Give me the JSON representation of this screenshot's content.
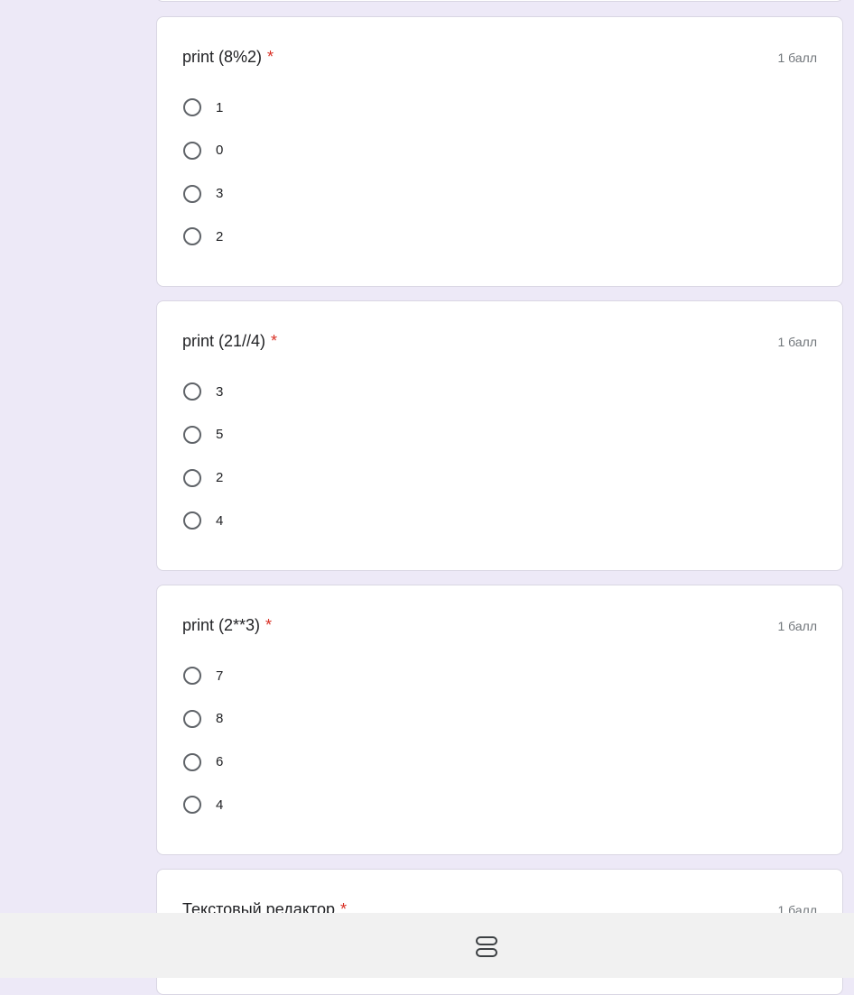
{
  "questions": [
    {
      "title": "print (8%2)",
      "required_mark": "*",
      "points": "1 балл",
      "options": [
        "1",
        "0",
        "3",
        "2"
      ]
    },
    {
      "title": "print (21//4)",
      "required_mark": "*",
      "points": "1 балл",
      "options": [
        "3",
        "5",
        "2",
        "4"
      ]
    },
    {
      "title": "print (2**3)",
      "required_mark": "*",
      "points": "1 балл",
      "options": [
        "7",
        "8",
        "6",
        "4"
      ]
    },
    {
      "title": "Текстовый редактор",
      "required_mark": "*",
      "points": "1 балл"
    }
  ],
  "colors": {
    "page_background": "#ede9f7",
    "card_background": "#ffffff",
    "required": "#d93025",
    "points_text": "#70757a",
    "nav_bar": "#f1f1f1"
  },
  "icons": {
    "radio": "radio-unchecked-icon",
    "nav_home": "home-pill-icon"
  }
}
